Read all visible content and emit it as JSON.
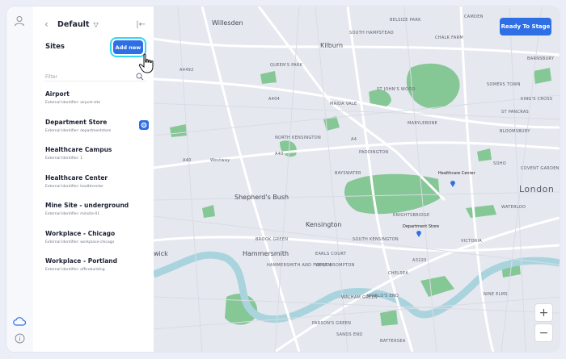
{
  "header": {
    "workspace": "Default"
  },
  "sites": {
    "title": "Sites",
    "add_label": "Add new",
    "filter_placeholder": "Filter",
    "items": [
      {
        "name": "Airport",
        "ext": "External Identifier: airport-site"
      },
      {
        "name": "Department Store",
        "ext": "External Identifier: departmentstore"
      },
      {
        "name": "Healthcare Campus",
        "ext": "External Identifier: 1"
      },
      {
        "name": "Healthcare Center",
        "ext": "External Identifier: healthcenter"
      },
      {
        "name": "Mine Site - underground",
        "ext": "External Identifier: minsite-01"
      },
      {
        "name": "Workplace - Chicago",
        "ext": "External Identifier: workplace-chicago"
      },
      {
        "name": "Workplace - Portland",
        "ext": "External Identifier: officebuilding"
      }
    ]
  },
  "map": {
    "ready_label": "Ready To Stage",
    "zoom_in": "+",
    "zoom_out": "−",
    "labels": {
      "willesden": "Willesden",
      "kilburn": "Kilburn",
      "shepherds_bush": "Shepherd's Bush",
      "kensington": "Kensington",
      "hammersmith": "Hammersmith",
      "london": "London",
      "wick": "wick",
      "a404": "A404",
      "a40": "A40",
      "a4492": "A4492",
      "a4": "A4",
      "a3220": "A3220",
      "belsize": "BELSIZE PARK",
      "camden": "CAMDEN",
      "chalk_farm": "CHALK FARM",
      "barnsbury": "BARNSBURY",
      "south_hampstead": "SOUTH HAMPSTEAD",
      "queens_park": "QUEEN'S PARK",
      "st_johns_wood": "ST JOHN'S WOOD",
      "somers_town": "SOMERS TOWN",
      "kings_cross": "KING'S CROSS",
      "st_pancras": "ST PANCRAS",
      "maida_vale": "MAIDA VALE",
      "marylebone": "MARYLEBONE",
      "north_kensington": "NORTH KENSINGTON",
      "bloomsbury": "BLOOMSBURY",
      "paddington": "PADDINGTON",
      "bayswater": "BAYSWATER",
      "soho": "SOHO",
      "covent_garden": "COVENT GARDEN",
      "knightsbridge": "KNIGHTSBRIDGE",
      "south_kensington": "SOUTH KENSINGTON",
      "victoria": "VICTORIA",
      "brook_green": "BROOK GREEN",
      "earls_court": "EARLS COURT",
      "west_brompton": "WEST BROMPTON",
      "chelsea": "CHELSEA",
      "fulham": "HAMMERSMITH AND FULHAM",
      "battersea": "BATTERSEA",
      "walham_green": "WALHAM GREEN",
      "worlds_end": "WORLD'S END",
      "parsons_green": "PARSON'S GREEN",
      "sands_end": "SANDS END",
      "nine_elms": "NINE ELMS",
      "waterloo": "WATERLOO",
      "westwood": "Westway",
      "healthcare_center": "Healthcare Center",
      "department_store": "Department Store"
    }
  },
  "colors": {
    "accent": "#2f6fe6",
    "highlight": "#35d6f5",
    "park": "#78c28a",
    "water": "#a9d4de"
  }
}
